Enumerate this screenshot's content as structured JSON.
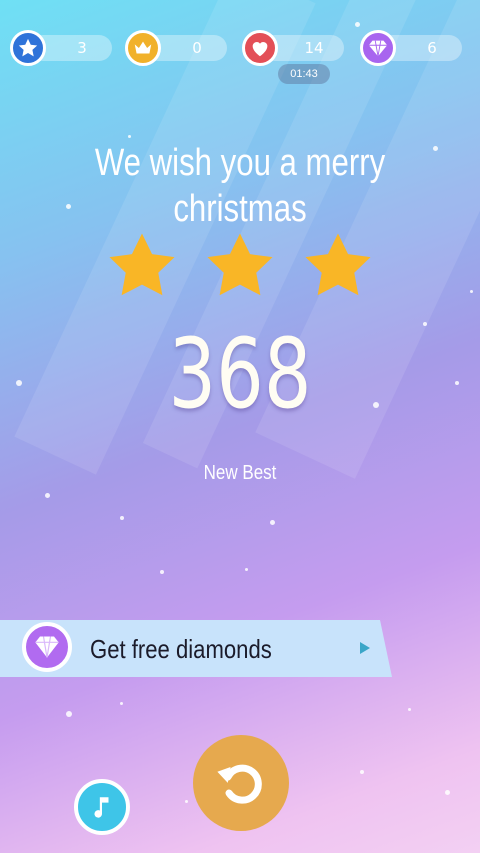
{
  "hud": {
    "stars": {
      "icon": "star-icon",
      "count": "3",
      "color": "#2f73d9"
    },
    "crowns": {
      "icon": "crown-icon",
      "count": "0",
      "color": "#f1b12a"
    },
    "lives": {
      "icon": "heart-icon",
      "count": "14",
      "color": "#e34f57",
      "timer": "01:43"
    },
    "diamonds": {
      "icon": "diamond-icon",
      "count": "6",
      "color": "#a865ef"
    }
  },
  "result": {
    "song_title": "We wish you a merry christmas",
    "stars_earned": 3,
    "star_color": "#f9b626",
    "score": "368",
    "subtitle": "New Best"
  },
  "offer": {
    "label": "Get free diamonds",
    "icon": "diamond-icon",
    "arrow_icon": "play-arrow-icon",
    "banner_color": "#c8e3fb"
  },
  "controls": {
    "replay_icon": "replay-icon",
    "music_icon": "music-note-icon",
    "replay_color": "#e6a94e",
    "music_color": "#3ec5e8"
  }
}
